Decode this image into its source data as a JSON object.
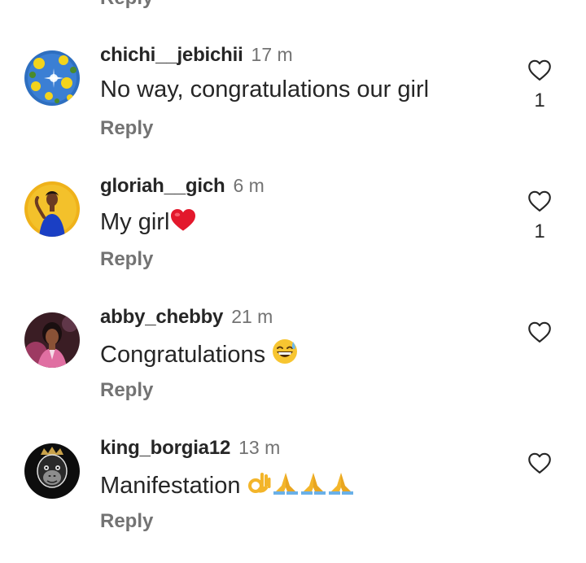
{
  "reply_label": "Reply",
  "comments": [
    {
      "username": "chichi__jebichii",
      "time": "17 m",
      "text": "No way,  congratulations our girl",
      "likes": "1",
      "avatar": "avatar-yellow-flowers"
    },
    {
      "username": "gloriah__gich",
      "time": "6 m",
      "text": "My girl",
      "emoji": [
        "red-heart-icon"
      ],
      "likes": "1",
      "avatar": "avatar-woman-blue-dress"
    },
    {
      "username": "abby_chebby",
      "time": "21 m",
      "text": "Congratulations ",
      "emoji": [
        "grinning-sweat-face-icon"
      ],
      "likes": "",
      "avatar": "avatar-woman-dark"
    },
    {
      "username": "king_borgia12",
      "time": "13 m",
      "text": "Manifestation ",
      "emoji": [
        "ok-hand-icon",
        "folded-hands-icon",
        "folded-hands-icon",
        "folded-hands-icon"
      ],
      "likes": "",
      "avatar": "avatar-gorilla-crown"
    }
  ],
  "colors": {
    "text": "#262626",
    "secondary": "#737373",
    "heart_outline": "#262626",
    "background": "#ffffff"
  }
}
